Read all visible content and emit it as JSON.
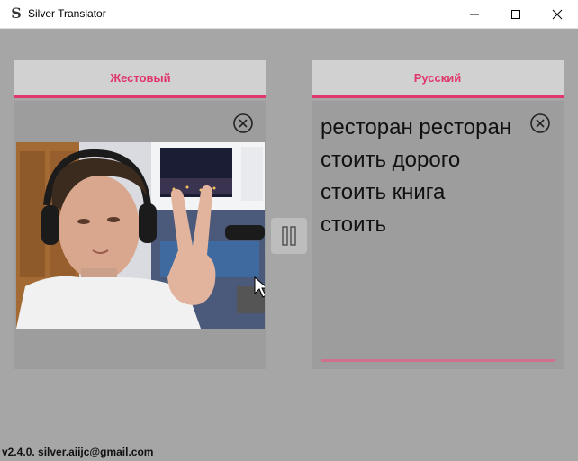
{
  "window": {
    "title": "Silver Translator",
    "icon_letter": "S"
  },
  "left_panel": {
    "header": "Жестовый"
  },
  "right_panel": {
    "header": "Русский",
    "lines": [
      "ресторан ресторан",
      "стоить дорого",
      "стоить книга",
      "стоить"
    ]
  },
  "footer": {
    "text": "v2.4.0. silver.aiijc@gmail.com"
  },
  "icons": {
    "app": "silver-s-icon",
    "clear": "close-circle-icon",
    "pause": "pause-icon"
  },
  "colors": {
    "accent": "#e0366b",
    "background": "#a6a6a6",
    "panel": "#9d9d9d",
    "header": "#d1d1d1"
  }
}
